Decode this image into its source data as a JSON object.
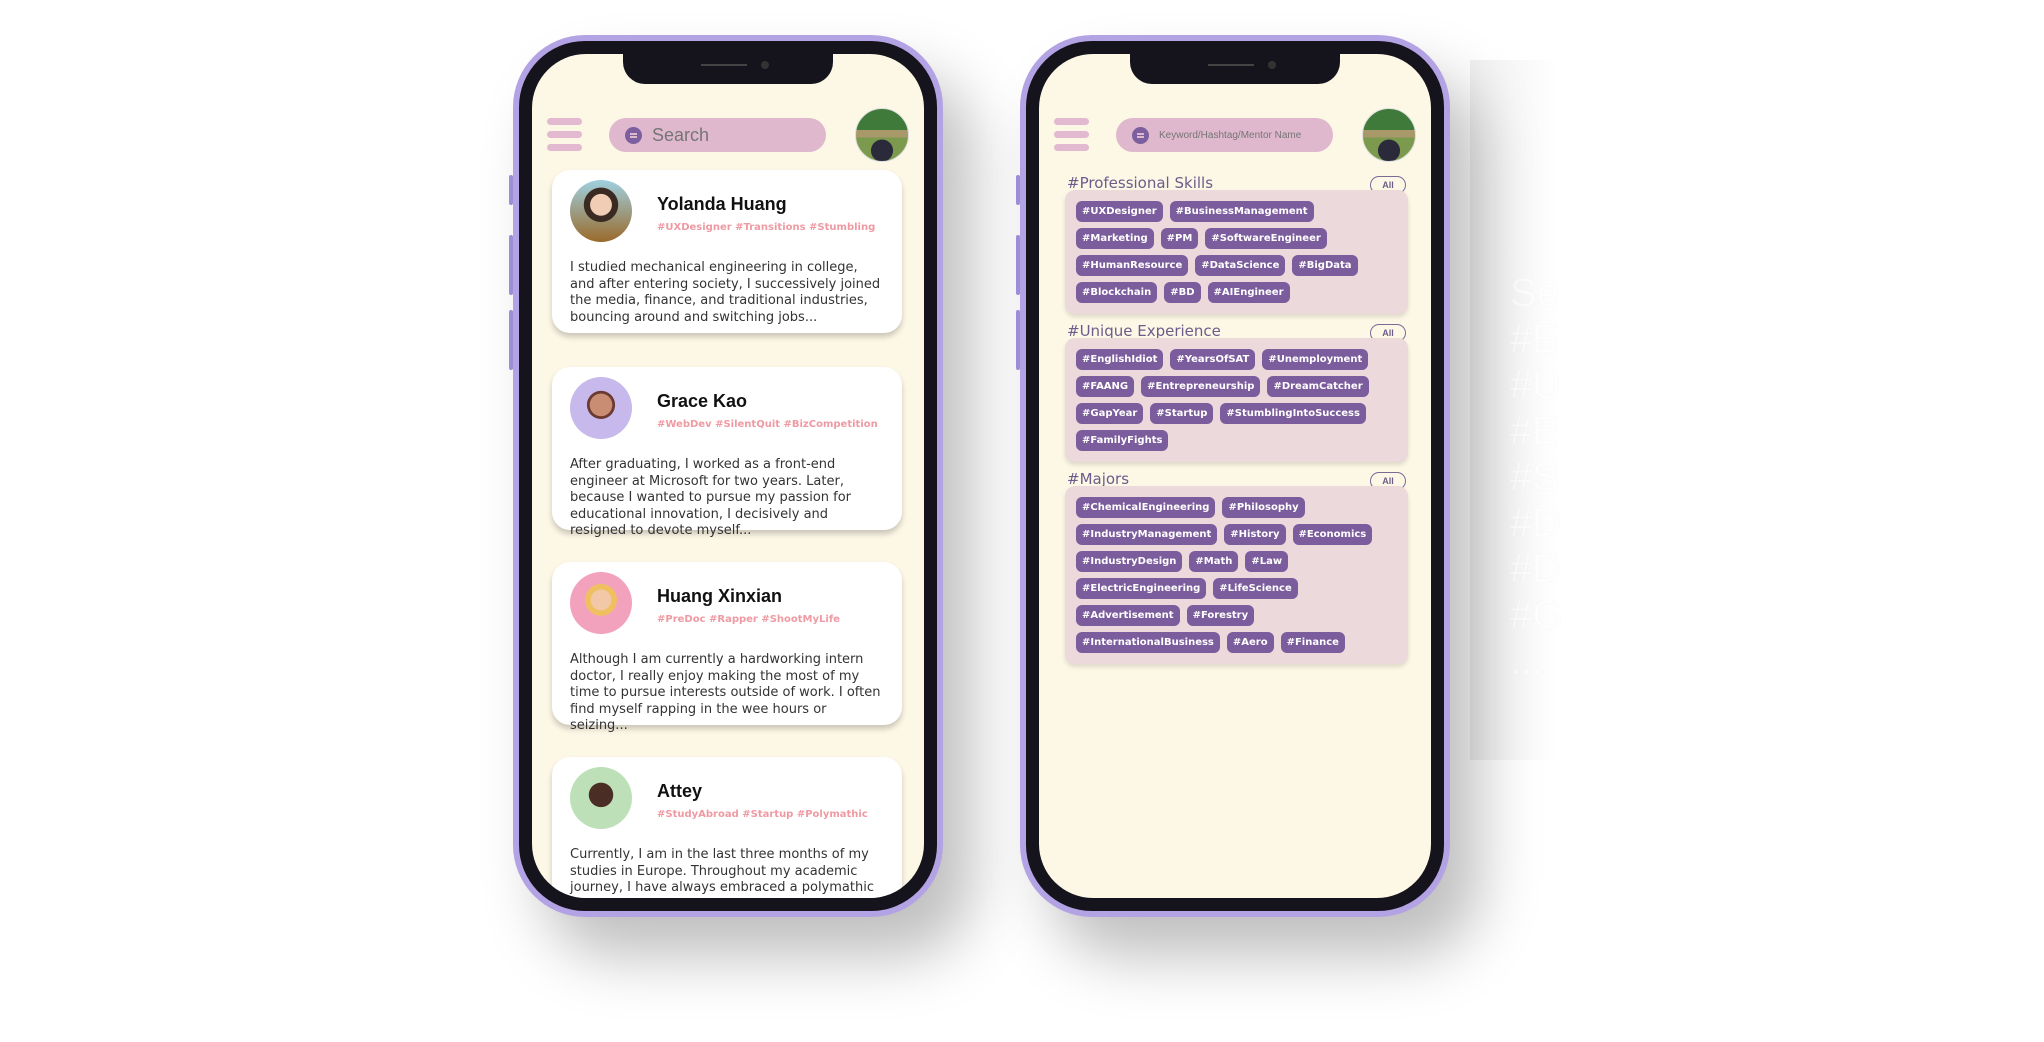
{
  "colors": {
    "bezel": "#b4a3e4",
    "screen": "#fdf7e6",
    "tag": "#7b5c9c",
    "hashtag": "#ef9aa3",
    "search": "#dfb8cd",
    "panel": "#ecd9dc"
  },
  "feed": {
    "search_placeholder": "Search",
    "mentors": [
      {
        "name": "Yolanda Huang",
        "tags": "#UXDesigner  #Transitions #Stumbling",
        "bio": "I studied mechanical engineering in college, and after entering society, I successively joined the media, finance, and traditional industries, bouncing around and switching jobs..."
      },
      {
        "name": "Grace Kao",
        "tags": "#WebDev  #SilentQuit #BizCompetition",
        "bio": "After graduating, I worked as a front-end engineer at Microsoft for two years. Later, because I wanted to pursue my passion for educational innovation, I decisively and resigned to devote myself..."
      },
      {
        "name": "Huang Xinxian",
        "tags": "#PreDoc #Rapper  #ShootMyLife",
        "bio": "Although I am currently a hardworking intern doctor, I really enjoy making the most of my time to pursue interests outside of work. I often find myself rapping in the wee hours or seizing..."
      },
      {
        "name": "Attey",
        "tags": "#StudyAbroad  #Startup  #Polymathic",
        "bio": "Currently, I am in the last three months of my studies in Europe. Throughout my academic journey, I have always embraced a polymathic"
      }
    ]
  },
  "explore": {
    "search_placeholder": "Keyword/Hashtag/Mentor Name",
    "all_label": "All",
    "sections": [
      {
        "title": "#Professional Skills",
        "tags": [
          "#UXDesigner",
          "#BusinessManagement",
          "#Marketing",
          "#PM",
          "#SoftwareEngineer",
          "#HumanResource",
          "#DataScience",
          "#BigData",
          "#Blockchain",
          "#BD",
          "#AIEngineer"
        ]
      },
      {
        "title": "#Unique Experience",
        "tags": [
          "#EnglishIdiot",
          "#YearsOfSAT",
          "#Unemployment",
          "#FAANG",
          "#Entrepreneurship",
          "#DreamCatcher",
          "#GapYear",
          "#Startup",
          "#StumblingIntoSuccess",
          "#FamilyFights"
        ]
      },
      {
        "title": "#Majors",
        "tags": [
          "#ChemicalEngineering",
          "#Philosophy",
          "#IndustryManagement",
          "#History",
          "#Economics",
          "#IndustryDesign",
          "#Math",
          "#Law",
          "#ElectricEngineering",
          "#LifeScience",
          "#Advertisement",
          "#Forestry",
          "#InternationalBusiness",
          "#Aero",
          "#Finance"
        ]
      }
    ]
  },
  "ghost_text": [
    "Se",
    "#E",
    "#U",
    "#E",
    "#S",
    "#D",
    "#D",
    "#G",
    "..."
  ]
}
